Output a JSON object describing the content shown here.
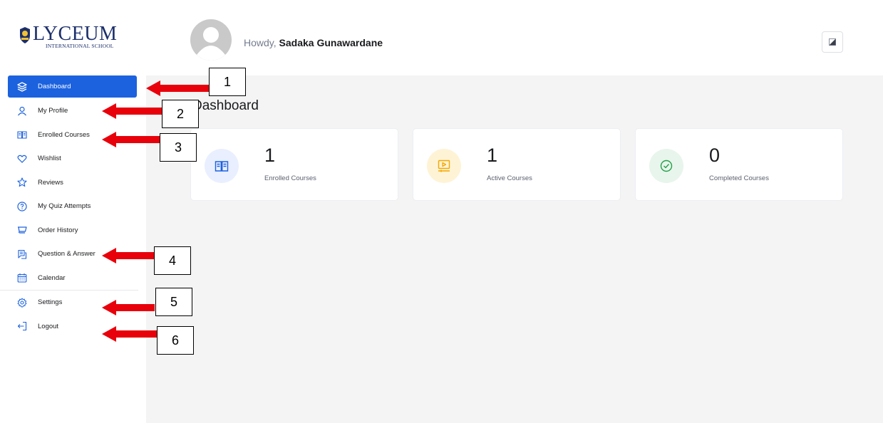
{
  "logo": {
    "title": "LYCEUM",
    "subtitle": "INTERNATIONAL SCHOOL"
  },
  "header": {
    "greeting": "Howdy,",
    "user_name": "Sadaka Gunawardane"
  },
  "sidebar": {
    "items": [
      {
        "label": "Dashboard",
        "icon": "dashboard-icon",
        "active": true
      },
      {
        "label": "My Profile",
        "icon": "user-icon"
      },
      {
        "label": "Enrolled Courses",
        "icon": "book-icon"
      },
      {
        "label": "Wishlist",
        "icon": "heart-icon"
      },
      {
        "label": "Reviews",
        "icon": "star-icon"
      },
      {
        "label": "My Quiz Attempts",
        "icon": "question-icon"
      },
      {
        "label": "Order History",
        "icon": "cart-icon"
      },
      {
        "label": "Question & Answer",
        "icon": "qa-icon"
      },
      {
        "label": "Calendar",
        "icon": "calendar-icon"
      },
      {
        "label": "Settings",
        "icon": "gear-icon"
      },
      {
        "label": "Logout",
        "icon": "logout-icon"
      }
    ]
  },
  "main": {
    "title": "Dashboard",
    "cards": [
      {
        "value": "1",
        "label": "Enrolled Courses",
        "icon": "book-icon",
        "color": "#1c62df"
      },
      {
        "value": "1",
        "label": "Active Courses",
        "icon": "video-icon",
        "color": "#f3a800"
      },
      {
        "value": "0",
        "label": "Completed Courses",
        "icon": "check-circle-icon",
        "color": "#24a148"
      }
    ]
  },
  "annotations": {
    "labels": [
      "1",
      "2",
      "3",
      "4",
      "5",
      "6"
    ],
    "arrow_color": "#e8000b"
  },
  "colors": {
    "accent": "#1c62df",
    "background": "#f4f4f4"
  }
}
